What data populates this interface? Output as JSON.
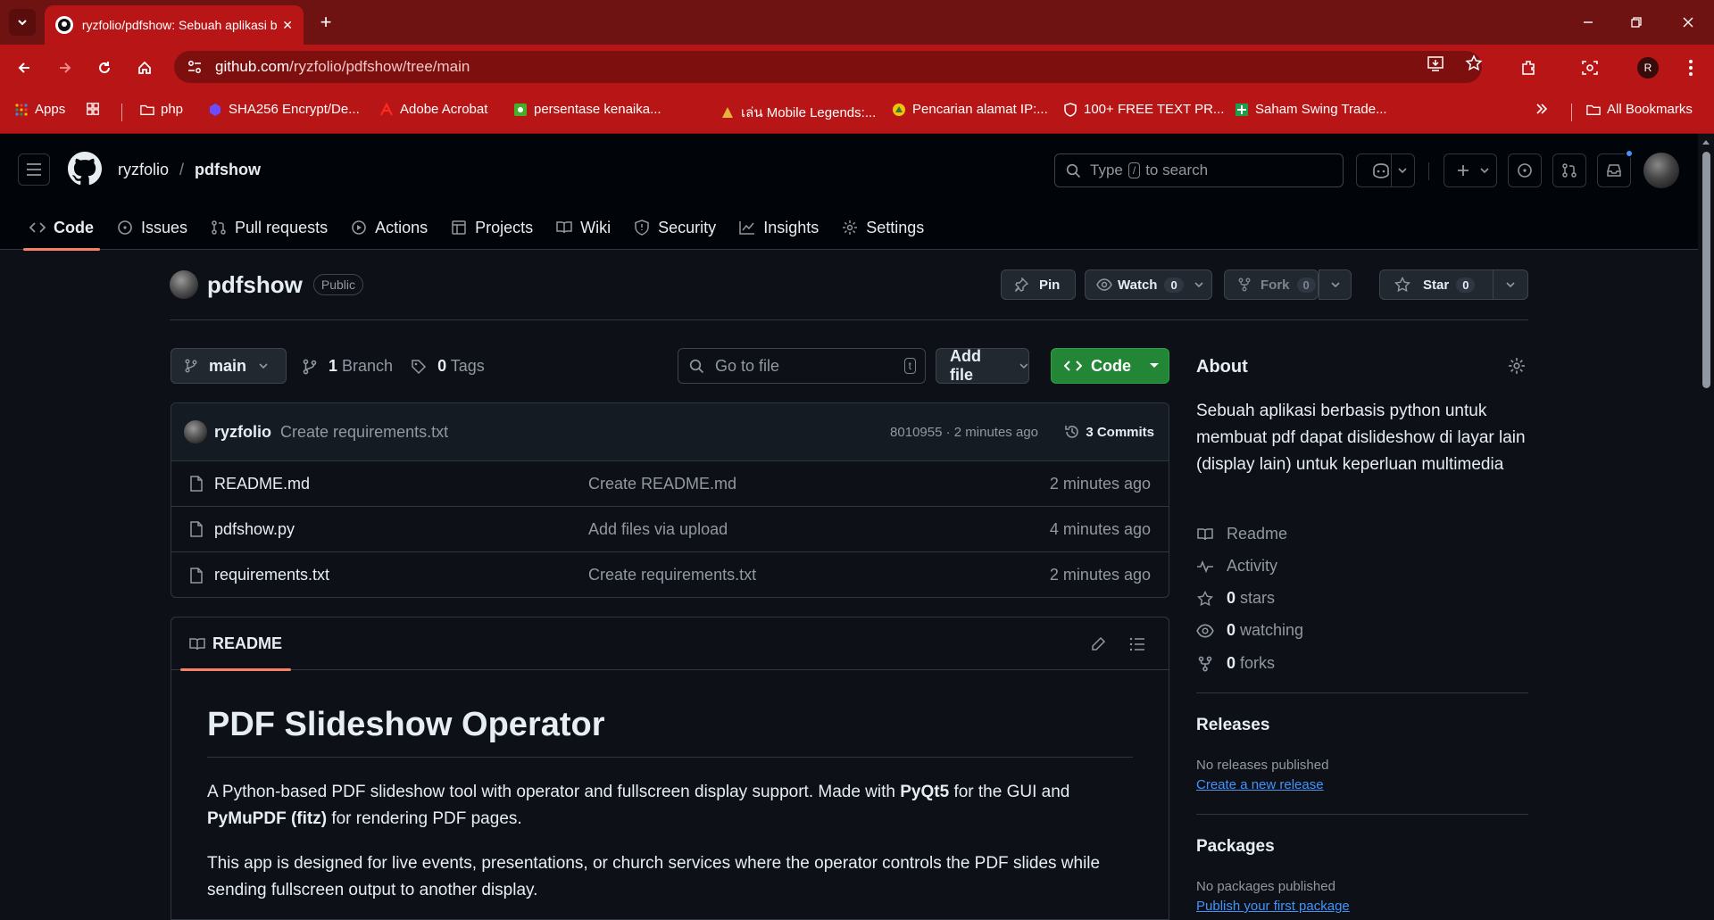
{
  "browser": {
    "tab_title": "ryzfolio/pdfshow: Sebuah aplikasi berbasis python",
    "url_host": "github.com",
    "url_path": "/ryzfolio/pdfshow/tree/main",
    "bookmarks": [
      {
        "label": "Apps"
      },
      {
        "label": "php"
      },
      {
        "label": "SHA256 Encrypt/De..."
      },
      {
        "label": "Adobe Acrobat"
      },
      {
        "label": "persentase kenaika..."
      },
      {
        "label": "เล่น Mobile Legends:..."
      },
      {
        "label": "Pencarian alamat IP:..."
      },
      {
        "label": "100+ FREE TEXT PR..."
      },
      {
        "label": "Saham Swing Trade..."
      }
    ],
    "all_bookmarks": "All Bookmarks",
    "profile_initial": "R"
  },
  "header": {
    "owner": "ryzfolio",
    "separator": "/",
    "repo": "pdfshow",
    "search_prefix": "Type",
    "search_key": "/",
    "search_suffix": "to search"
  },
  "repo_nav": [
    {
      "label": "Code"
    },
    {
      "label": "Issues"
    },
    {
      "label": "Pull requests"
    },
    {
      "label": "Actions"
    },
    {
      "label": "Projects"
    },
    {
      "label": "Wiki"
    },
    {
      "label": "Security"
    },
    {
      "label": "Insights"
    },
    {
      "label": "Settings"
    }
  ],
  "repo": {
    "name": "pdfshow",
    "visibility": "Public",
    "pin_label": "Pin",
    "watch_label": "Watch",
    "watch_count": "0",
    "fork_label": "Fork",
    "fork_count": "0",
    "star_label": "Star",
    "star_count": "0"
  },
  "file_toolbar": {
    "branch": "main",
    "branch_count": "1",
    "branch_label": "Branch",
    "tag_count": "0",
    "tag_label": "Tags",
    "goto_placeholder": "Go to file",
    "goto_key": "t",
    "add_file": "Add file",
    "code_button": "Code"
  },
  "latest_commit": {
    "author": "ryzfolio",
    "message": "Create requirements.txt",
    "meta": "8010955 · 2 minutes ago",
    "commits_label": "3 Commits"
  },
  "files": [
    {
      "name": "README.md",
      "message": "Create README.md",
      "time": "2 minutes ago"
    },
    {
      "name": "pdfshow.py",
      "message": "Add files via upload",
      "time": "4 minutes ago"
    },
    {
      "name": "requirements.txt",
      "message": "Create requirements.txt",
      "time": "2 minutes ago"
    }
  ],
  "readme": {
    "tab_label": "README",
    "h1": "PDF Slideshow Operator",
    "p1_a": "A Python-based PDF slideshow tool with operator and fullscreen display support. Made with ",
    "p1_b": "PyQt5",
    "p1_c": " for the GUI and ",
    "p1_d": "PyMuPDF (fitz)",
    "p1_e": " for rendering PDF pages.",
    "p2": "This app is designed for live events, presentations, or church services where the operator controls the PDF slides while sending fullscreen output to another display."
  },
  "about": {
    "heading": "About",
    "description": "Sebuah aplikasi berbasis python untuk membuat pdf dapat dislideshow di layar lain (display lain) untuk keperluan multimedia",
    "readme": "Readme",
    "activity": "Activity",
    "stars_count": "0",
    "stars_label": "stars",
    "watching_count": "0",
    "watching_label": "watching",
    "forks_count": "0",
    "forks_label": "forks"
  },
  "releases": {
    "heading": "Releases",
    "empty": "No releases published",
    "link": "Create a new release"
  },
  "packages": {
    "heading": "Packages",
    "empty": "No packages published",
    "link": "Publish your first package"
  }
}
